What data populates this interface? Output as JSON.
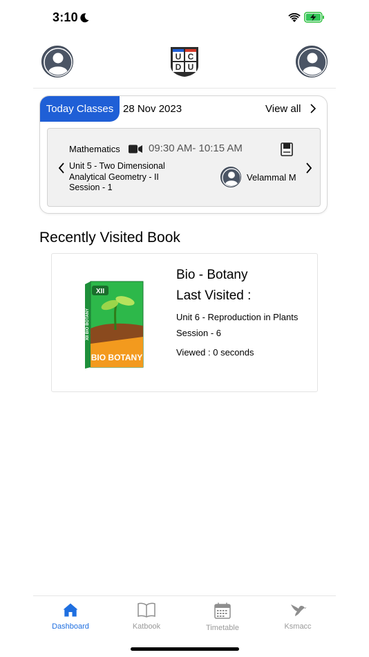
{
  "status_bar": {
    "time": "3:10"
  },
  "today_classes": {
    "tag": "Today Classes",
    "date": "28 Nov 2023",
    "view_all": "View all",
    "class": {
      "subject": "Mathematics",
      "time": "09:30 AM- 10:15 AM",
      "unit_line1": "Unit 5 - Two Dimensional",
      "unit_line2": "Analytical Geometry - II",
      "session": "Session - 1",
      "teacher": "Velammal M"
    }
  },
  "recently_visited": {
    "title": "Recently Visited Book",
    "book": {
      "cover_label_top": "XII",
      "cover_label_spine": "XII BIO BOTANY",
      "cover_label_bottom": "BIO BOTANY",
      "name": "Bio - Botany",
      "last_visited": "Last Visited  :",
      "unit": "Unit 6 - Reproduction in Plants",
      "session": "Session - 6",
      "viewed": "Viewed : 0 seconds"
    }
  },
  "logo": {
    "letters": [
      "U",
      "C",
      "D",
      "U"
    ]
  },
  "tabs": [
    {
      "label": "Dashboard",
      "icon": "home-icon",
      "active": true
    },
    {
      "label": "Katbook",
      "icon": "book-open-icon",
      "active": false
    },
    {
      "label": "Timetable",
      "icon": "calendar-icon",
      "active": false
    },
    {
      "label": "Ksmacc",
      "icon": "bird-icon",
      "active": false
    }
  ],
  "colors": {
    "accent": "#1f5fd6",
    "tab_active": "#1f6fe0",
    "tab_inactive": "#9a9a9a"
  }
}
